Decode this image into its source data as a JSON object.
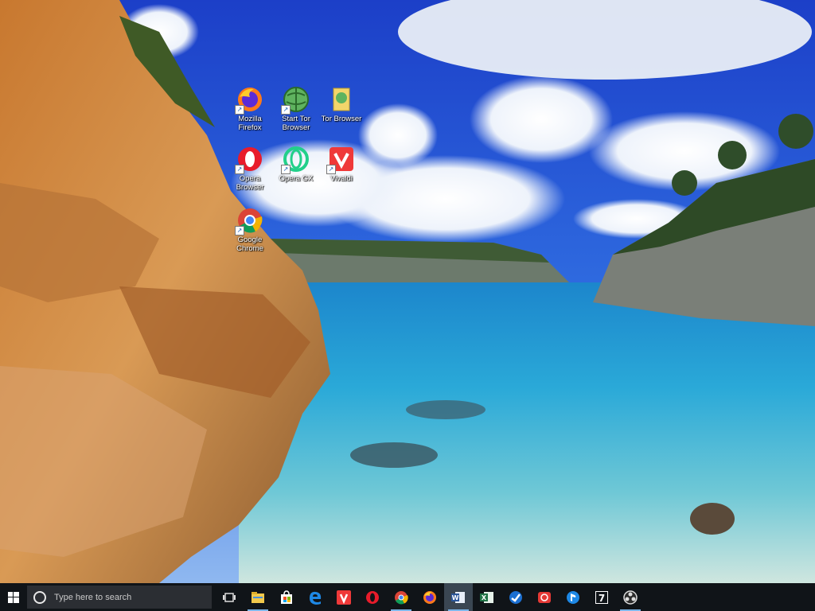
{
  "desktop": {
    "icons": [
      {
        "name": "mozilla-firefox",
        "label": "Mozilla\nFirefox"
      },
      {
        "name": "start-tor-browser",
        "label": "Start Tor\nBrowser"
      },
      {
        "name": "tor-browser",
        "label": "Tor Browser"
      },
      {
        "name": "opera-browser",
        "label": "Opera\nBrowser"
      },
      {
        "name": "opera-gx",
        "label": "Opera GX"
      },
      {
        "name": "vivaldi",
        "label": "Vivaldi"
      },
      {
        "name": "google-chrome",
        "label": "Google\nChrome"
      }
    ]
  },
  "taskbar": {
    "search_placeholder": "Type here to search",
    "apps": [
      "task-view",
      "file-explorer",
      "microsoft-store",
      "edge",
      "vivaldi",
      "opera",
      "chrome",
      "firefox",
      "word",
      "excel",
      "steam",
      "app-red",
      "playstation",
      "7-zip",
      "obs"
    ]
  },
  "colors": {
    "taskbar": "#101418",
    "accent": "#7cb6ea"
  }
}
